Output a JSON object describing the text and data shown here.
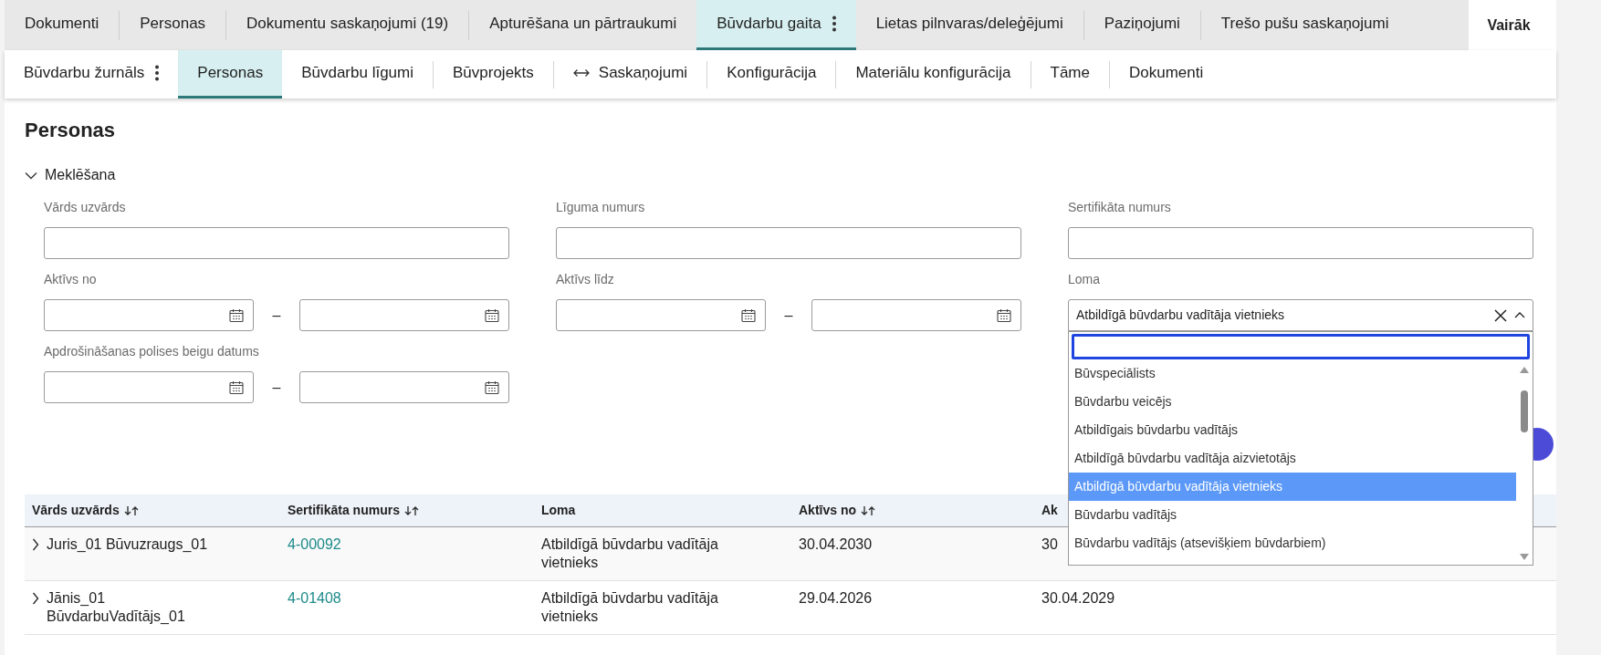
{
  "top_tabs": [
    {
      "label": "Dokumenti",
      "selected": false,
      "menu": false
    },
    {
      "label": "Personas",
      "selected": false,
      "menu": false
    },
    {
      "label": "Dokumentu saskaņojumi (19)",
      "selected": false,
      "menu": false
    },
    {
      "label": "Apturēšana un pārtraukumi",
      "selected": false,
      "menu": false
    },
    {
      "label": "Būvdarbu gaita",
      "selected": true,
      "menu": true
    },
    {
      "label": "Lietas pilnvaras/deleģējumi",
      "selected": false,
      "menu": false
    },
    {
      "label": "Paziņojumi",
      "selected": false,
      "menu": false
    },
    {
      "label": "Trešo pušu saskaņojumi",
      "selected": false,
      "menu": false
    }
  ],
  "more_button": {
    "label": "Vairāk"
  },
  "sub_tabs": [
    {
      "label": "Būvdarbu žurnāls",
      "selected": false,
      "menu": true,
      "kind": "plain"
    },
    {
      "label": "Personas",
      "selected": true,
      "menu": false,
      "kind": "plain"
    },
    {
      "label": "Būvdarbu līgumi",
      "selected": false,
      "menu": false,
      "kind": "plain"
    },
    {
      "label": "Būvprojekts",
      "selected": false,
      "menu": false,
      "kind": "plain"
    },
    {
      "label": "Saskaņojumi",
      "selected": false,
      "menu": false,
      "kind": "with_icon"
    },
    {
      "label": "Konfigurācija",
      "selected": false,
      "menu": false,
      "kind": "plain"
    },
    {
      "label": "Materiālu konfigurācija",
      "selected": false,
      "menu": false,
      "kind": "plain"
    },
    {
      "label": "Tāme",
      "selected": false,
      "menu": false,
      "kind": "plain"
    },
    {
      "label": "Dokumenti",
      "selected": false,
      "menu": false,
      "kind": "plain"
    }
  ],
  "page_title": "Personas",
  "search": {
    "title": "Meklēšana",
    "expanded": true,
    "fields": [
      {
        "kind": "text",
        "label": "Vārds uzvārds"
      },
      {
        "kind": "text",
        "label": "Līguma numurs"
      },
      {
        "kind": "text",
        "label": "Sertifikāta numurs"
      },
      {
        "kind": "date_range",
        "label": "Aktīvs no",
        "separator": "–"
      },
      {
        "kind": "date_range",
        "label": "Aktīvs līdz",
        "separator": "–"
      },
      {
        "kind": "select",
        "label": "Loma",
        "value": "Atbildīgā būvdarbu vadītāja vietnieks",
        "expanded": true,
        "options": [
          {
            "label": "Būvspeciālists",
            "selected": false
          },
          {
            "label": "Būvdarbu veicējs",
            "selected": false
          },
          {
            "label": "Atbildīgais būvdarbu vadītājs",
            "selected": false
          },
          {
            "label": "Atbildīgā būvdarbu vadītāja aizvietotājs",
            "selected": false
          },
          {
            "label": "Atbildīgā būvdarbu vadītāja vietnieks",
            "selected": true
          },
          {
            "label": "Būvdarbu vadītājs",
            "selected": false
          },
          {
            "label": "Būvdarbu vadītājs (atsevišķiem būvdarbiem)",
            "selected": false
          }
        ]
      },
      {
        "kind": "date_range",
        "label": "Apdrošināšanas polises beigu datums",
        "separator": "–"
      }
    ]
  },
  "table": {
    "columns": [
      {
        "label": "Vārds uzvārds",
        "sortable": true,
        "kind": "name"
      },
      {
        "label": "Sertifikāta numurs",
        "sortable": true,
        "kind": "link"
      },
      {
        "label": "Loma",
        "sortable": false,
        "kind": "text"
      },
      {
        "label": "Aktīvs no",
        "sortable": true,
        "kind": "text"
      },
      {
        "label": "Ak",
        "sortable": false,
        "kind": "text"
      }
    ],
    "rows": [
      {
        "expanded": false,
        "cells": [
          "Juris_01 Būvuzraugs_01",
          "4-00092",
          "Atbildīgā būvdarbu vadītāja vietnieks",
          "30.04.2030",
          "30"
        ]
      },
      {
        "expanded": false,
        "cells": [
          "Jānis_01 BūvdarbuVadītājs_01",
          "4-01408",
          "Atbildīgā būvdarbu vadītāja vietnieks",
          "29.04.2026",
          "30.04.2029"
        ]
      }
    ]
  }
}
